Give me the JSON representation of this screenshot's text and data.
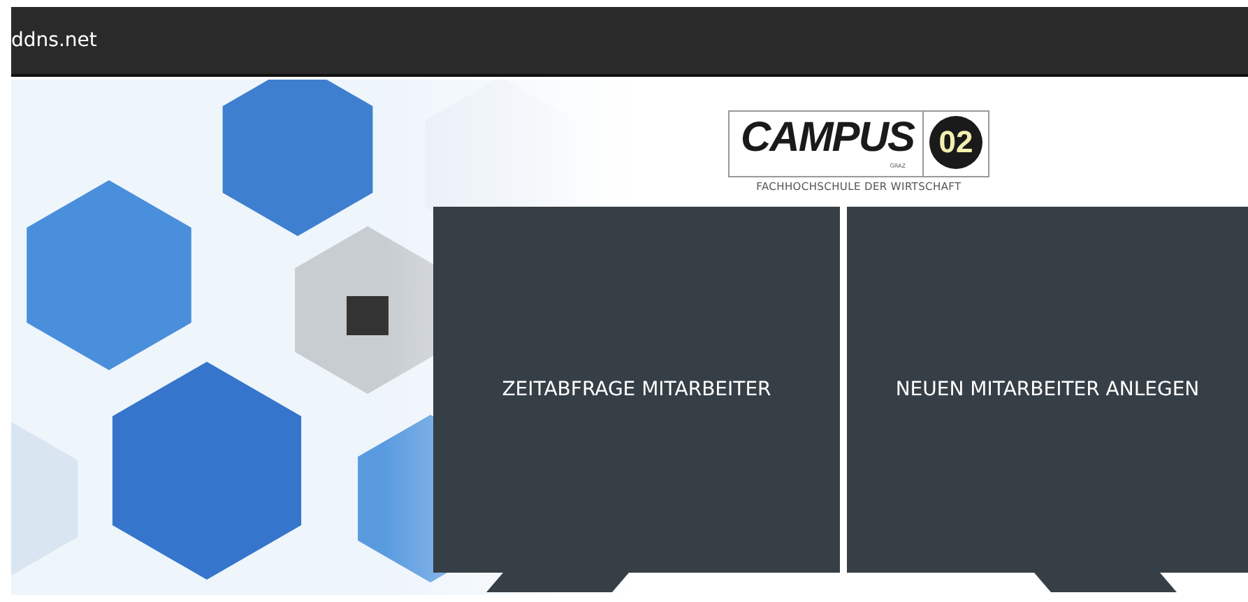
{
  "header": {
    "title": "ddns.net"
  },
  "logo": {
    "name": "CAMPUS",
    "number": "02",
    "city": "GRAZ",
    "subtitle": "FACHHOCHSCHULE DER WIRTSCHAFT"
  },
  "tiles": [
    {
      "label": "ZEITABFRAGE MITARBEITER"
    },
    {
      "label": "NEUEN MITARBEITER ANLEGEN"
    }
  ]
}
